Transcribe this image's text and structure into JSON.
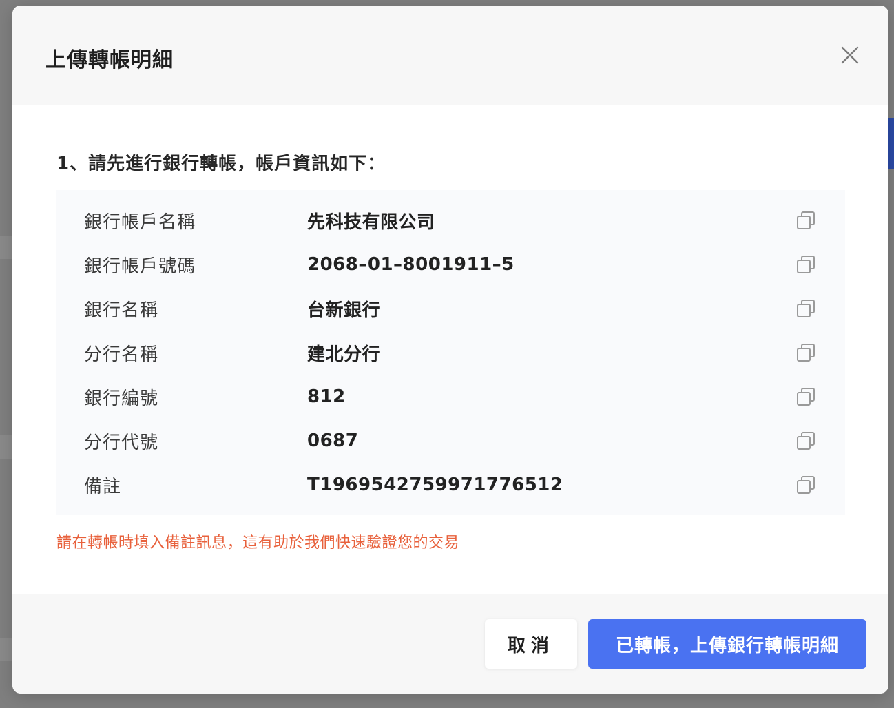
{
  "modal": {
    "title": "上傳轉帳明細",
    "step_title": "1、請先進行銀行轉帳，帳戶資訊如下：",
    "rows": [
      {
        "label": "銀行帳戶名稱",
        "value": "先科技有限公司"
      },
      {
        "label": "銀行帳戶號碼",
        "value": "2068–01–8001911–5"
      },
      {
        "label": "銀行名稱",
        "value": "台新銀行"
      },
      {
        "label": "分行名稱",
        "value": "建北分行"
      },
      {
        "label": "銀行編號",
        "value": "812"
      },
      {
        "label": "分行代號",
        "value": "0687"
      },
      {
        "label": "備註",
        "value": "T1969542759971776512"
      }
    ],
    "notice": "請在轉帳時填入備註訊息，這有助於我們快速驗證您的交易",
    "cancel_label": "取消",
    "confirm_label": "已轉帳，上傳銀行轉帳明細"
  },
  "colors": {
    "accent": "#4a72f1",
    "notice": "#e8613c"
  },
  "icons": {
    "close": "close-icon",
    "copy": "copy-icon"
  }
}
